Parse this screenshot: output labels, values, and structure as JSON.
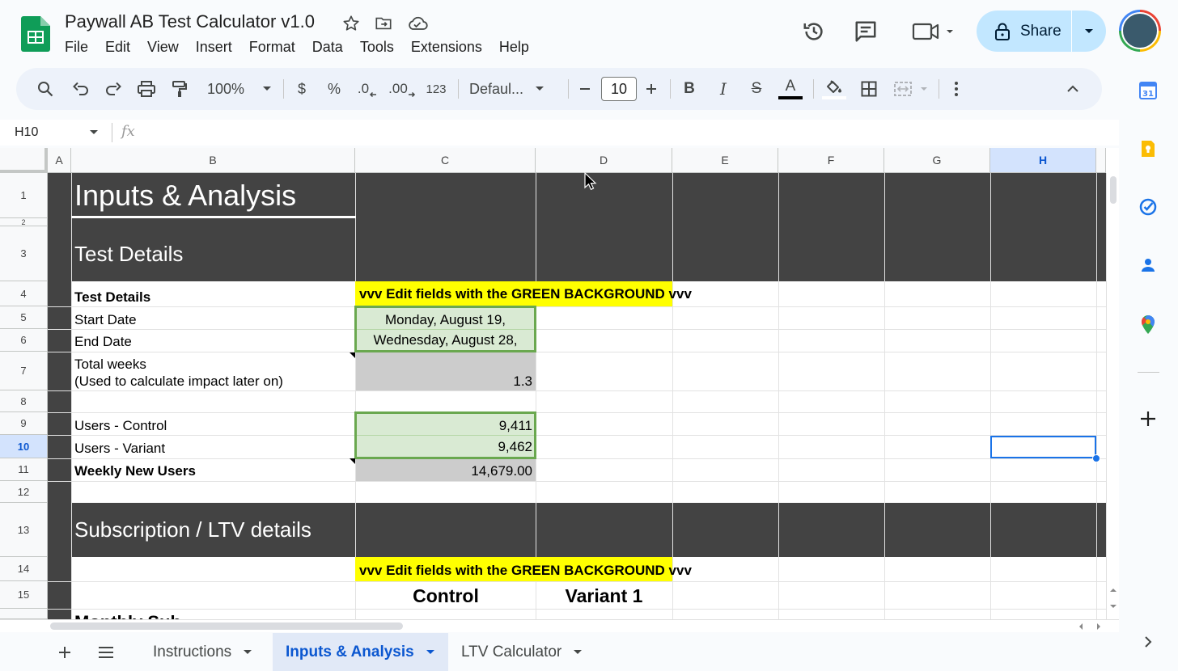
{
  "app": {
    "doc_title": "Paywall AB Test Calculator v1.0",
    "menu": [
      "File",
      "Edit",
      "View",
      "Insert",
      "Format",
      "Data",
      "Tools",
      "Extensions",
      "Help"
    ],
    "share_label": "Share"
  },
  "toolbar": {
    "zoom": "100%",
    "currency": "$",
    "percent": "%",
    "dec_decrease": ".0",
    "dec_increase": ".00",
    "number_format": "123",
    "font": "Defaul...",
    "font_size": "10",
    "bold": "B",
    "italic": "I",
    "strike": "S",
    "text_color_letter": "A"
  },
  "formula_bar": {
    "name_box": "H10",
    "fx": "fx",
    "value": ""
  },
  "columns": [
    "A",
    "B",
    "C",
    "D",
    "E",
    "F",
    "G",
    "H"
  ],
  "rows": [
    "1",
    "2",
    "3",
    "4",
    "5",
    "6",
    "7",
    "8",
    "9",
    "10",
    "11",
    "12",
    "13",
    "14",
    "15"
  ],
  "selected": {
    "column": "H",
    "row": "10"
  },
  "cells": {
    "title": "Inputs & Analysis",
    "section_test": "Test Details",
    "b4": "Test Details",
    "edit_banner": "vvv Edit fields with the GREEN BACKGROUND vvv",
    "b5": "Start Date",
    "c5": "Monday, August 19,",
    "b6": "End Date",
    "c6": "Wednesday, August 28,",
    "b7_line1": "Total weeks",
    "b7_line2": "(Used to calculate impact later on)",
    "c7": "1.3",
    "b9": "Users - Control",
    "c9": "9,411",
    "b10": "Users - Variant",
    "c10": "9,462",
    "b11": "Weekly New Users",
    "c11": "14,679.00",
    "section_sub": "Subscription / LTV details",
    "edit_banner_2": "vvv Edit fields with the GREEN BACKGROUND vvv",
    "c15": "Control",
    "d15": "Variant 1",
    "b16_partial": "Monthly Sub"
  },
  "tabs": [
    {
      "label": "Instructions",
      "active": false
    },
    {
      "label": "Inputs & Analysis",
      "active": true
    },
    {
      "label": "LTV Calculator",
      "active": false
    }
  ],
  "colors": {
    "dark_band": "#434343",
    "yellow": "#ffff00",
    "green_fill": "#d9ead3",
    "green_border": "#6aa84f",
    "gray_fill": "#cccccc",
    "selection": "#1a73e8",
    "share_bg": "#c2e7ff"
  },
  "icons": {
    "title_bar": [
      "star-icon",
      "move-folder-icon",
      "cloud-saved-icon"
    ],
    "top_right": [
      "version-history-icon",
      "comments-icon",
      "meet-icon"
    ],
    "side_panel": [
      "calendar-icon",
      "keep-icon",
      "tasks-icon",
      "contacts-icon",
      "maps-icon",
      "add-icon"
    ]
  }
}
